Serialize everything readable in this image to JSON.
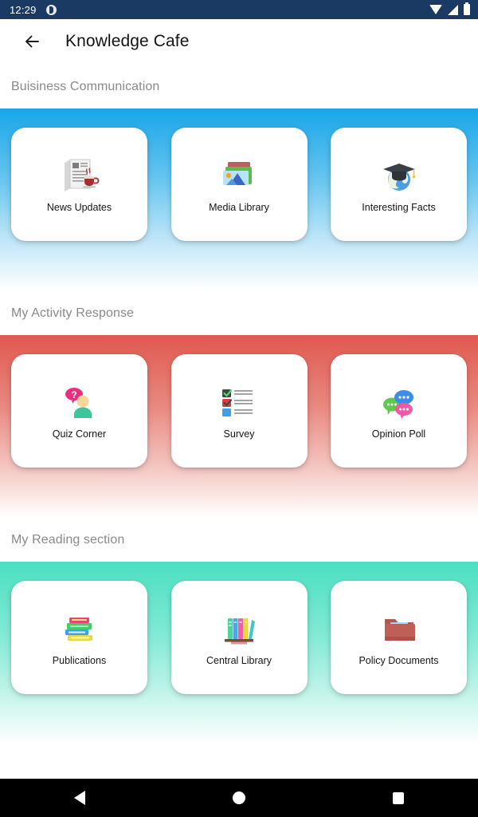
{
  "status_bar": {
    "time": "12:29",
    "app_icon": "app-notification-icon",
    "icons": [
      "wifi-icon",
      "cellular-signal-icon",
      "battery-icon"
    ]
  },
  "app_bar": {
    "back_icon": "back-arrow-icon",
    "title": "Knowledge Cafe"
  },
  "sections": [
    {
      "title": "Buisiness Communication",
      "band_color": "#18a6e8",
      "cards": [
        {
          "label": "News Updates",
          "icon": "newspaper-coffee-icon"
        },
        {
          "label": "Media Library",
          "icon": "photo-stack-icon"
        },
        {
          "label": "Interesting Facts",
          "icon": "globe-graduation-cap-icon"
        }
      ]
    },
    {
      "title": "My Activity Response",
      "band_color": "#e0584f",
      "cards": [
        {
          "label": "Quiz Corner",
          "icon": "person-question-bubble-icon"
        },
        {
          "label": "Survey",
          "icon": "checklist-icon"
        },
        {
          "label": "Opinion Poll",
          "icon": "speech-bubbles-icon"
        }
      ]
    },
    {
      "title": "My Reading section",
      "band_color": "#4bdfc1",
      "cards": [
        {
          "label": "Publications",
          "icon": "book-stack-icon"
        },
        {
          "label": "Central Library",
          "icon": "bookshelf-icon"
        },
        {
          "label": "Policy Documents",
          "icon": "folder-documents-icon"
        }
      ]
    }
  ],
  "nav_bar": {
    "back": "nav-back-icon",
    "home": "nav-home-icon",
    "recents": "nav-recents-icon"
  }
}
